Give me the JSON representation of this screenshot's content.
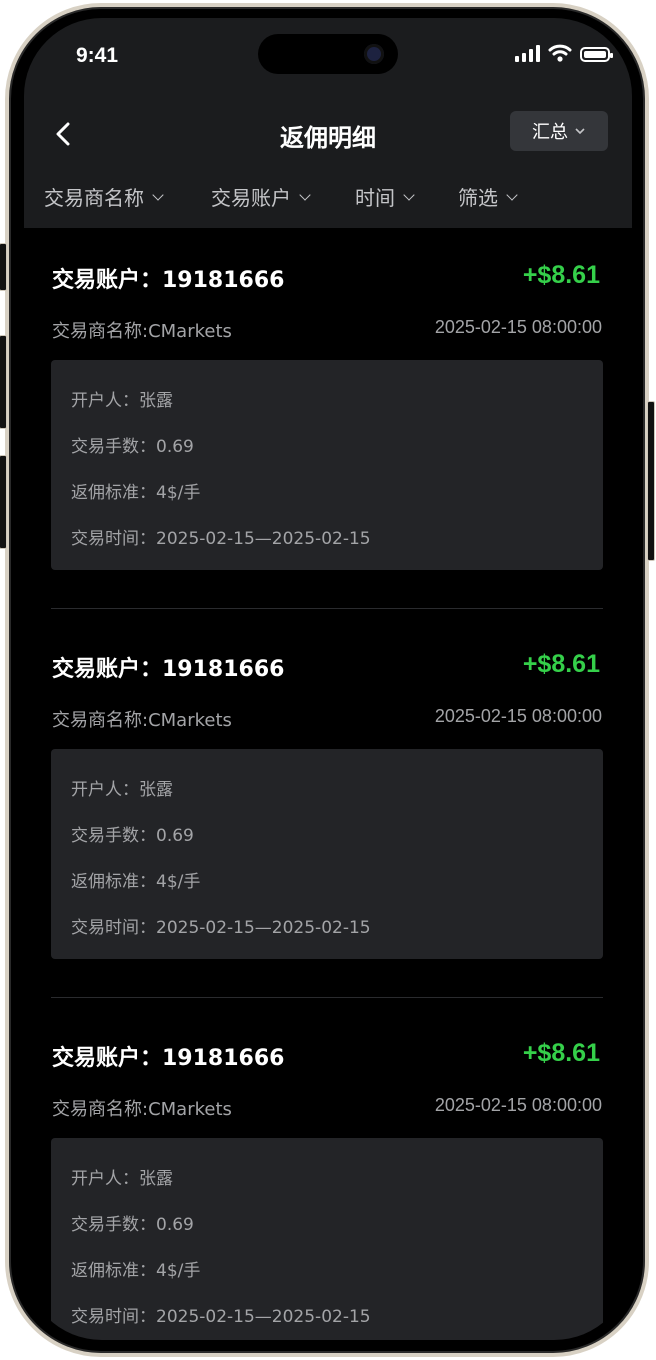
{
  "status_bar": {
    "time": "9:41"
  },
  "header": {
    "title": "返佣明细",
    "summary_button": "汇总"
  },
  "filters": [
    {
      "label": "交易商名称"
    },
    {
      "label": "交易账户"
    },
    {
      "label": "时间"
    },
    {
      "label": "筛选"
    }
  ],
  "records": [
    {
      "account": "交易账户：19181666",
      "amount": "+$8.61",
      "broker": "交易商名称:CMarkets",
      "timestamp": "2025-02-15 08:00:00",
      "opener": "开户人：张露",
      "lots": "交易手数：0.69",
      "rebate_standard": "返佣标准：4$/手",
      "trade_period": "交易时间：2025-02-15—2025-02-15"
    },
    {
      "account": "交易账户：19181666",
      "amount": "+$8.61",
      "broker": "交易商名称:CMarkets",
      "timestamp": "2025-02-15 08:00:00",
      "opener": "开户人：张露",
      "lots": "交易手数：0.69",
      "rebate_standard": "返佣标准：4$/手",
      "trade_period": "交易时间：2025-02-15—2025-02-15"
    },
    {
      "account": "交易账户：19181666",
      "amount": "+$8.61",
      "broker": "交易商名称:CMarkets",
      "timestamp": "2025-02-15 08:00:00",
      "opener": "开户人：张露",
      "lots": "交易手数：0.69",
      "rebate_standard": "返佣标准：4$/手",
      "trade_period": "交易时间：2025-02-15—2025-02-15"
    }
  ],
  "colors": {
    "background": "#000000",
    "header_bg": "#1b1c1e",
    "card_detail_bg": "#232427",
    "amount_positive": "#35d04a",
    "secondary_text": "#a3a4a7"
  }
}
